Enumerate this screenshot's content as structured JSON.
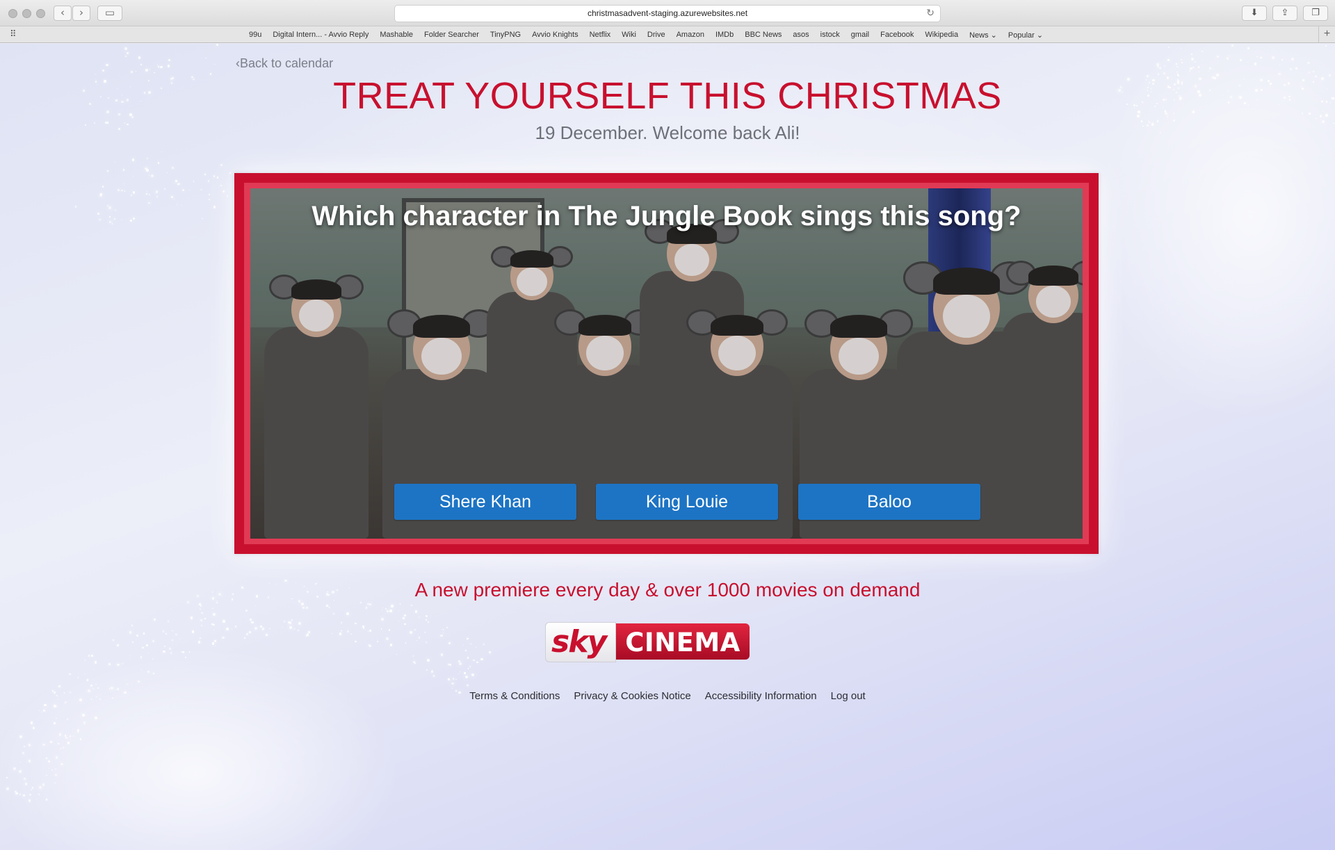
{
  "browser": {
    "url": "christmasadvent-staging.azurewebsites.net",
    "icons": {
      "back": "chevron-left-icon",
      "forward": "chevron-right-icon",
      "sidebar": "sidebar-icon",
      "reload": "reload-icon",
      "download": "download-icon",
      "share": "share-icon",
      "tabs": "tabs-icon",
      "apps": "apps-grid-icon"
    },
    "bookmarks": [
      "99u",
      "Digital Intern... - Avvio Reply",
      "Mashable",
      "Folder Searcher",
      "TinyPNG",
      "Avvio Knights",
      "Netflix",
      "Wiki",
      "Drive",
      "Amazon",
      "IMDb",
      "BBC News",
      "asos",
      "istock",
      "gmail",
      "Facebook",
      "Wikipedia",
      "News ⌄",
      "Popular ⌄"
    ]
  },
  "page": {
    "back_link": "Back to calendar",
    "title": "TREAT YOURSELF THIS CHRISTMAS",
    "subtitle": "19 December. Welcome back Ali!",
    "quiz": {
      "question": "Which character in The Jungle Book sings this song?",
      "answers": [
        "Shere Khan",
        "King Louie",
        "Baloo"
      ]
    },
    "premiere_text": "A new premiere every day & over 1000 movies on demand",
    "logo": {
      "sky": "sky",
      "cinema": "CINEMA"
    },
    "footer_links": [
      "Terms & Conditions",
      "Privacy & Cookies Notice",
      "Accessibility Information",
      "Log out"
    ]
  },
  "colors": {
    "brand_red": "#c8102e",
    "answer_blue": "#1d74c4",
    "subtitle_gray": "#6e7079"
  }
}
